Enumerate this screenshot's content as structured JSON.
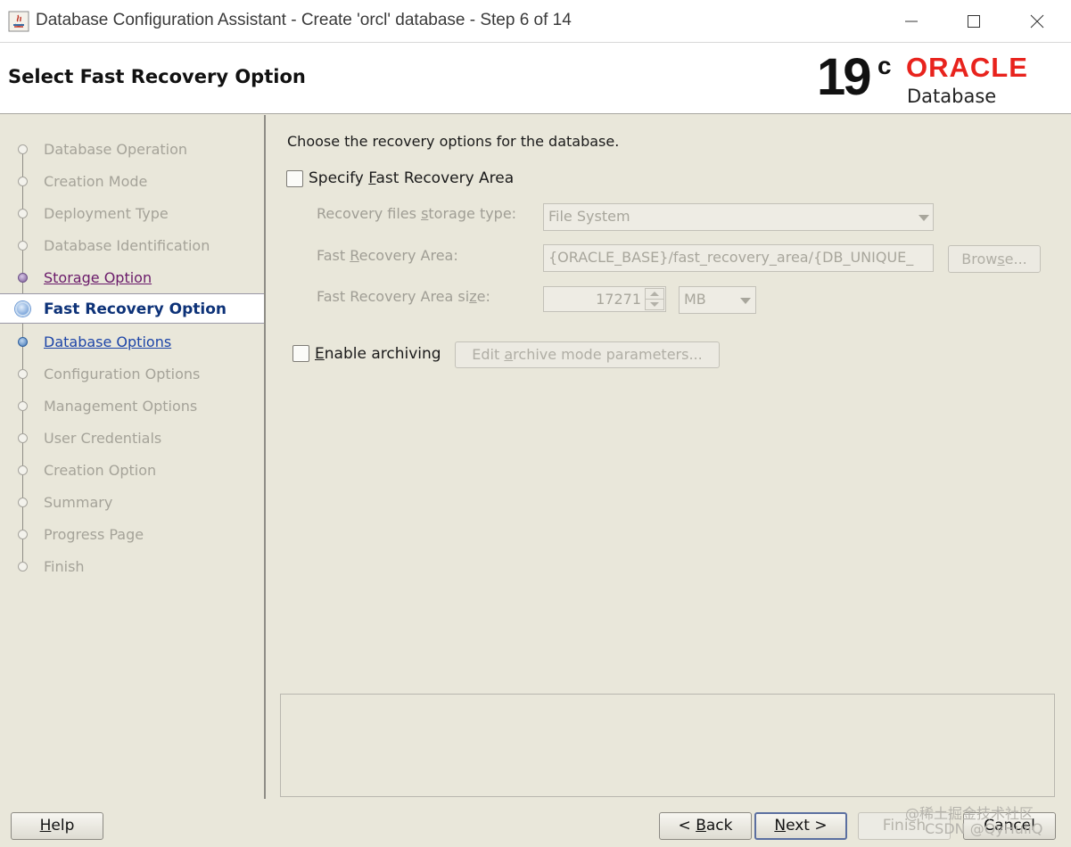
{
  "window": {
    "title": "Database Configuration Assistant - Create 'orcl' database - Step 6 of 14"
  },
  "header": {
    "page_title": "Select Fast Recovery Option",
    "logo": {
      "version": "19",
      "version_suffix": "c",
      "brand": "ORACLE",
      "product": "Database"
    }
  },
  "nav": {
    "items": [
      {
        "label": "Database Operation",
        "state": "disabled"
      },
      {
        "label": "Creation Mode",
        "state": "disabled"
      },
      {
        "label": "Deployment Type",
        "state": "disabled"
      },
      {
        "label": "Database Identification",
        "state": "disabled"
      },
      {
        "label": "Storage Option",
        "state": "visited"
      },
      {
        "label": "Fast Recovery Option",
        "state": "current"
      },
      {
        "label": "Database Options",
        "state": "next"
      },
      {
        "label": "Configuration Options",
        "state": "disabled"
      },
      {
        "label": "Management Options",
        "state": "disabled"
      },
      {
        "label": "User Credentials",
        "state": "disabled"
      },
      {
        "label": "Creation Option",
        "state": "disabled"
      },
      {
        "label": "Summary",
        "state": "disabled"
      },
      {
        "label": "Progress Page",
        "state": "disabled"
      },
      {
        "label": "Finish",
        "state": "disabled"
      }
    ]
  },
  "content": {
    "description": "Choose the recovery options for the database.",
    "fra_checkbox": {
      "label_pre": "Specify ",
      "label_mnemonic": "F",
      "label_post": "ast Recovery Area",
      "checked": false
    },
    "storage_type": {
      "label_pre": "Recovery files ",
      "label_mnemonic": "s",
      "label_post": "torage type:",
      "value": "File System"
    },
    "fra_location": {
      "label_pre": "Fast ",
      "label_mnemonic": "R",
      "label_post": "ecovery Area:",
      "value": "{ORACLE_BASE}/fast_recovery_area/{DB_UNIQUE_",
      "browse_pre": "Brow",
      "browse_mnemonic": "s",
      "browse_post": "e..."
    },
    "fra_size": {
      "label_pre": "Fast Recovery Area si",
      "label_mnemonic": "z",
      "label_post": "e:",
      "value": "17271",
      "unit": "MB"
    },
    "archiving_checkbox": {
      "label_mnemonic": "E",
      "label_post": "nable archiving",
      "checked": false
    },
    "archive_params_button": {
      "pre": "Edit ",
      "mnemonic": "a",
      "post": "rchive mode parameters..."
    }
  },
  "footer": {
    "help_pre": "",
    "help_mnemonic": "H",
    "help_post": "elp",
    "back_pre": "< ",
    "back_mnemonic": "B",
    "back_post": "ack",
    "next_pre": "",
    "next_mnemonic": "N",
    "next_post": "ext >",
    "finish": "Finish",
    "cancel": "Cancel",
    "watermark_line1": "@稀土掘金技术社区",
    "watermark_line2": "CSDN @QyHuiiQ"
  },
  "colors": {
    "background": "#e9e7da",
    "current_step_text": "#0d3278",
    "visited_link": "#6a1a6a",
    "next_link": "#1c44a8",
    "oracle_red": "#e8231d"
  }
}
